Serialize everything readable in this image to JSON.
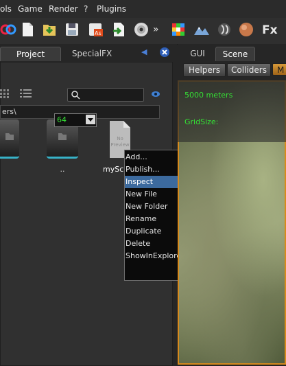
{
  "menu": {
    "items": [
      "ols",
      "Game",
      "Render",
      "?",
      "Plugins"
    ]
  },
  "toolbar": {
    "overflow": "»",
    "fx_label": "Fx",
    "icons": [
      "link-icon",
      "new-file-icon",
      "import-icon",
      "save-icon",
      "save-as-icon",
      "export-icon",
      "disc-icon",
      "cube-icon",
      "terrain-icon",
      "material-icon",
      "sphere-icon"
    ]
  },
  "left_panel": {
    "tabs": {
      "project": "Project",
      "specialfx": "SpecialFX"
    },
    "arrow": "◀",
    "path": "ers\\",
    "files": [
      {
        "label": ""
      },
      {
        "label": ".."
      },
      {
        "label": "mySc"
      }
    ],
    "preview_text": "No Preview"
  },
  "context_menu": {
    "items": [
      "Add...",
      "Publish...",
      "Inspect",
      "New File",
      "New Folder",
      "Rename",
      "Duplicate",
      "Delete",
      "ShowInExplorer"
    ],
    "selected": "Inspect"
  },
  "right_panel": {
    "tabs": {
      "gui": "GUI",
      "scene": "Scene"
    },
    "subtabs": {
      "helpers": "Helpers",
      "colliders": "Colliders",
      "more": "M"
    },
    "distance": "5000 meters",
    "gridsize_label": "GridSize:",
    "gridsize_value": "64"
  },
  "colors": {
    "accent_orange": "#d88a1c",
    "selection_blue": "#3c6a9e",
    "green_text": "#35e035",
    "folder_edge": "#37b2c7"
  }
}
